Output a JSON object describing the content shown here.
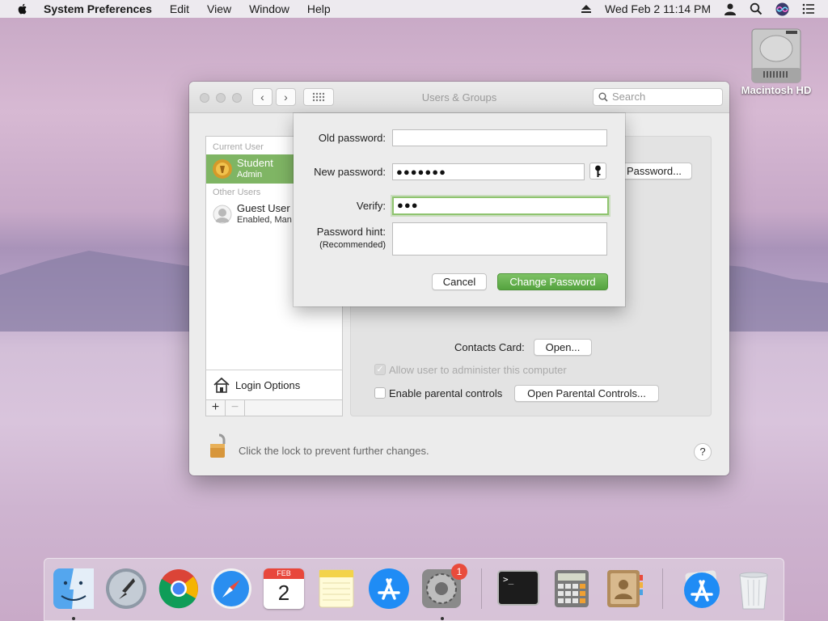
{
  "menubar": {
    "app": "System Preferences",
    "items": [
      "Edit",
      "View",
      "Window",
      "Help"
    ],
    "clock": "Wed Feb 2  11:14 PM"
  },
  "desktop": {
    "drive_label": "Macintosh HD"
  },
  "window": {
    "title": "Users & Groups",
    "search_placeholder": "Search",
    "sidebar": {
      "current_header": "Current User",
      "current_user": {
        "name": "Student",
        "role": "Admin"
      },
      "other_header": "Other Users",
      "other_user": {
        "name": "Guest User",
        "status": "Enabled, Man"
      },
      "login_options": "Login Options",
      "add": "+",
      "remove": "−"
    },
    "panel": {
      "password_button": "Password...",
      "contacts_label": "Contacts Card:",
      "open_button": "Open...",
      "allow_admin": "Allow user to administer this computer",
      "parental_label": "Enable parental controls",
      "parental_button": "Open Parental Controls..."
    },
    "lock_text": "Click the lock to prevent further changes.",
    "help": "?"
  },
  "sheet": {
    "old_label": "Old password:",
    "old_value": "",
    "new_label": "New password:",
    "new_value": "●●●●●●●",
    "verify_label": "Verify:",
    "verify_value": "●●●",
    "hint_label": "Password hint:",
    "hint_sub": "(Recommended)",
    "hint_value": "",
    "cancel": "Cancel",
    "change": "Change Password"
  },
  "dock": {
    "calendar_month": "FEB",
    "calendar_day": "2",
    "badge": "1",
    "terminal_prompt": ">_"
  },
  "colors": {
    "accent_green": "#6db352",
    "badge_red": "#e94b3c"
  }
}
